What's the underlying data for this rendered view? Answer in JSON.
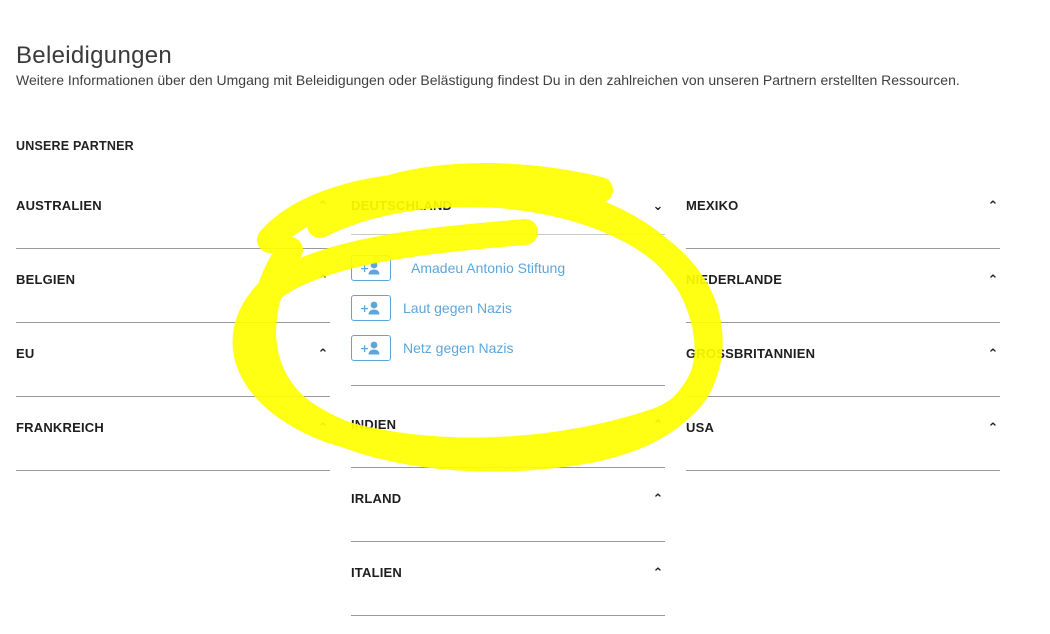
{
  "page": {
    "title": "Beleidigungen",
    "intro": "Weitere Informationen über den Umgang mit Beleidigungen oder Belästigung findest Du in den zahlreichen von unseren Partnern erstellten Ressourcen.",
    "partners_heading": "UNSERE PARTNER"
  },
  "icons": {
    "chevron_up": "chevron-up-icon",
    "chevron_down": "chevron-down-icon",
    "add_user": "add-user-icon"
  },
  "colors": {
    "link": "#5ea6d9",
    "annotation_highlight": "#ffff00"
  },
  "columns": {
    "left": [
      {
        "name": "AUSTRALIEN",
        "expanded": false
      },
      {
        "name": "BELGIEN",
        "expanded": false
      },
      {
        "name": "EU",
        "expanded": false
      },
      {
        "name": "FRANKREICH",
        "expanded": false
      }
    ],
    "middle": [
      {
        "name": "DEUTSCHLAND",
        "expanded": true,
        "resources": [
          "Amadeu Antonio Stiftung",
          "Laut gegen Nazis",
          "Netz gegen Nazis"
        ]
      },
      {
        "name": "INDIEN",
        "expanded": false
      },
      {
        "name": "IRLAND",
        "expanded": false
      },
      {
        "name": "ITALIEN",
        "expanded": false
      }
    ],
    "right": [
      {
        "name": "MEXIKO",
        "expanded": false
      },
      {
        "name": "NIEDERLANDE",
        "expanded": false
      },
      {
        "name": "GROSSBRITANNIEN",
        "expanded": false
      },
      {
        "name": "USA",
        "expanded": false
      }
    ]
  }
}
